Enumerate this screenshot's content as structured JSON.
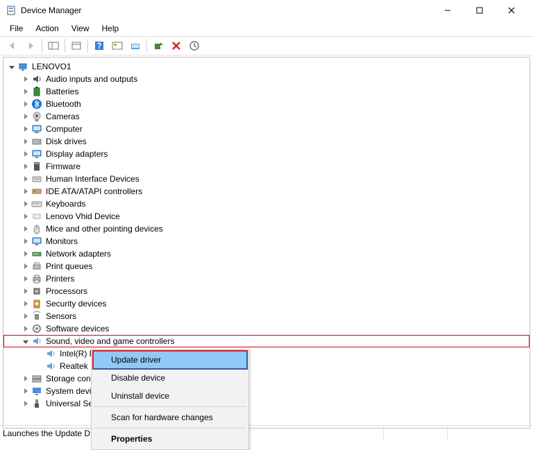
{
  "window": {
    "title": "Device Manager"
  },
  "menu": {
    "file": "File",
    "action": "Action",
    "view": "View",
    "help": "Help"
  },
  "tree": {
    "root": "LENOVO1",
    "items": [
      "Audio inputs and outputs",
      "Batteries",
      "Bluetooth",
      "Cameras",
      "Computer",
      "Disk drives",
      "Display adapters",
      "Firmware",
      "Human Interface Devices",
      "IDE ATA/ATAPI controllers",
      "Keyboards",
      "Lenovo Vhid Device",
      "Mice and other pointing devices",
      "Monitors",
      "Network adapters",
      "Print queues",
      "Printers",
      "Processors",
      "Security devices",
      "Sensors",
      "Software devices",
      "Sound, video and game controllers",
      "Storage cont",
      "System devic",
      "Universal Ser"
    ],
    "sound_children": [
      "Intel(R) D",
      "Realtek H"
    ]
  },
  "context": {
    "update": "Update driver",
    "disable": "Disable device",
    "uninstall": "Uninstall device",
    "scan": "Scan for hardware changes",
    "properties": "Properties"
  },
  "status": {
    "text": "Launches the Update Dri"
  },
  "icons": {
    "audio": "🔊",
    "battery": "🔋",
    "bluetooth": "BT",
    "camera": "📷",
    "computer": "🖥",
    "disk": "💽",
    "display": "🖥",
    "firmware": "▮",
    "hid": "⌨",
    "ide": "⚙",
    "keyboard": "⌨",
    "vhid": "▭",
    "mouse": "🖱",
    "monitor": "🖥",
    "network": "🖧",
    "printq": "🖨",
    "printer": "🖨",
    "cpu": "▣",
    "security": "🔒",
    "sensor": "📡",
    "software": "⚙",
    "sound": "🔊",
    "storage": "💾",
    "system": "💻",
    "usb": "🔌"
  }
}
